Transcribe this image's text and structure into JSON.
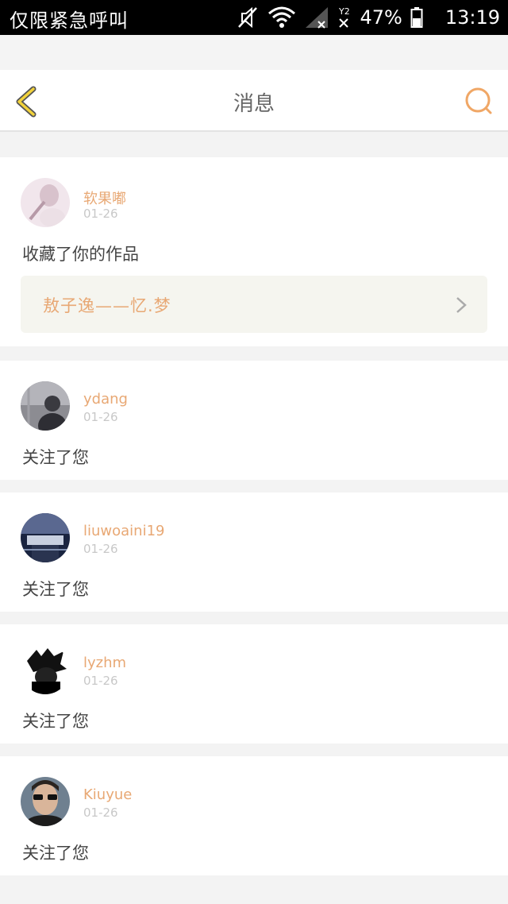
{
  "status_bar": {
    "carrier": "仅限紧急呼叫",
    "battery": "47%",
    "time": "13:19",
    "sim_label": "2"
  },
  "header": {
    "title": "消息",
    "back_icon": "chevron-left-icon",
    "search_icon": "search-icon"
  },
  "colors": {
    "accent": "#e8a874",
    "back_yellow": "#f2d23a",
    "search_orange": "#f0a766"
  },
  "messages": [
    {
      "username": "软果嘟",
      "date": "01-26",
      "action": "收藏了你的作品",
      "work": {
        "title": "敖子逸——忆.梦"
      }
    },
    {
      "username": "ydang",
      "date": "01-26",
      "action": "关注了您"
    },
    {
      "username": "liuwoaini19",
      "date": "01-26",
      "action": "关注了您"
    },
    {
      "username": "lyzhm",
      "date": "01-26",
      "action": "关注了您"
    },
    {
      "username": "Kiuyue",
      "date": "01-26",
      "action": "关注了您"
    }
  ]
}
